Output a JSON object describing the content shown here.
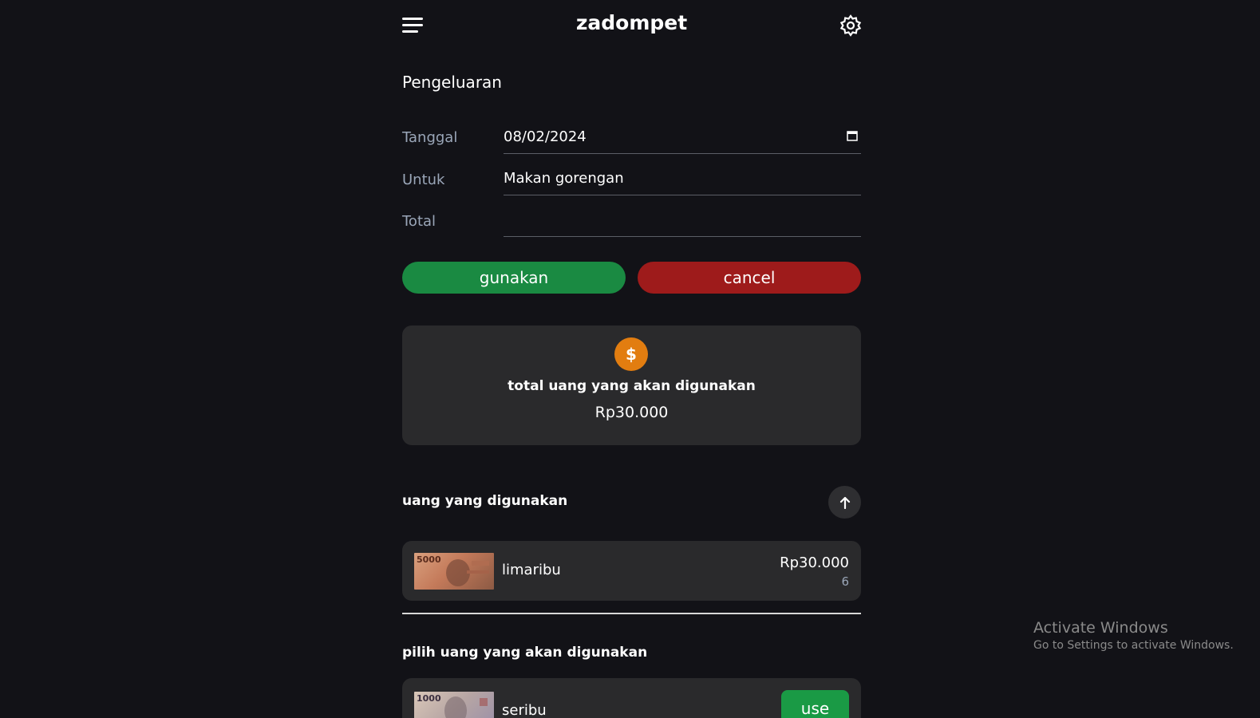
{
  "header": {
    "app_title": "zadompet",
    "menu_icon": "hamburger-menu-icon",
    "settings_icon": "gear-icon"
  },
  "form": {
    "title": "Pengeluaran",
    "date_label": "Tanggal",
    "date_value": "08/02/2024",
    "purpose_label": "Untuk",
    "purpose_value": "Makan gorengan",
    "total_label": "Total",
    "total_value": ""
  },
  "actions": {
    "confirm_label": "gunakan",
    "cancel_label": "cancel"
  },
  "summary": {
    "icon": "dollar-coin-icon",
    "coin_glyph": "$",
    "label": "total uang yang akan digunakan",
    "value": "Rp30.000"
  },
  "used": {
    "title": "uang yang digunakan",
    "items": [
      {
        "note_number": "5000",
        "name": "limaribu",
        "amount": "Rp30.000",
        "count": "6"
      }
    ]
  },
  "choose": {
    "title": "pilih uang yang akan digunakan",
    "items": [
      {
        "note_number": "1000",
        "name": "seribu",
        "button_label": "use"
      }
    ]
  },
  "watermark": {
    "line1": "Activate Windows",
    "line2": "Go to Settings to activate Windows."
  },
  "colors": {
    "background": "#121217",
    "card": "#2a2a2c",
    "green": "#1a8a42",
    "red": "#9e1b1b",
    "coin": "#e27d10"
  }
}
